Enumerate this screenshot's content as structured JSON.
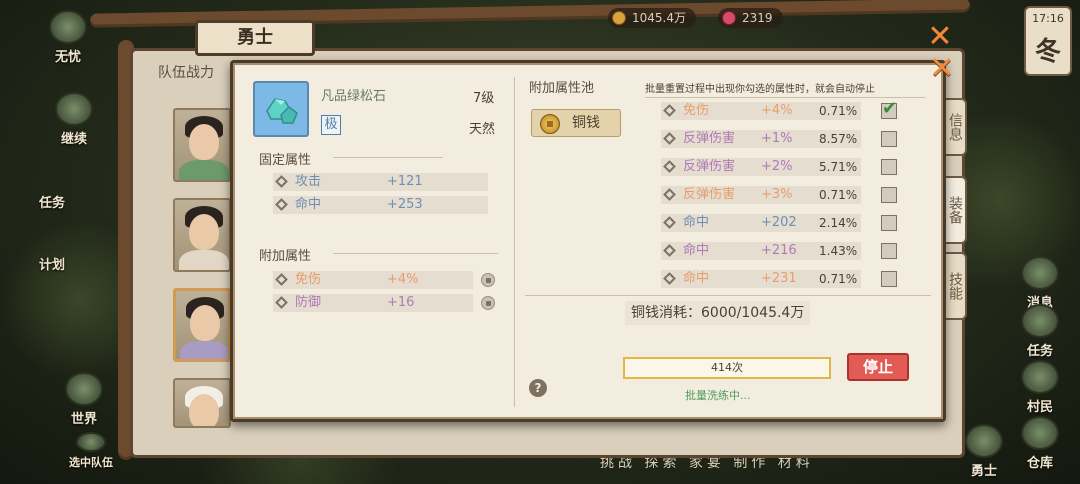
{
  "hud": {
    "coins": "1045.4万",
    "gems": "2319",
    "time": "17:16",
    "season": "冬",
    "left_menu": [
      {
        "label": "无忧"
      },
      {
        "label": "继续"
      },
      {
        "label": "任务"
      },
      {
        "label": "计划"
      },
      {
        "label": "世界"
      },
      {
        "label": "选中队伍"
      }
    ],
    "right_menu": [
      {
        "label": "消息"
      },
      {
        "label": "任务"
      },
      {
        "label": "村民"
      },
      {
        "label": "仓库"
      },
      {
        "label": "勇士"
      }
    ],
    "bottom_tabs": "挑战 探索 家宴 制作 材料"
  },
  "back_panel": {
    "title": "勇士",
    "tab_label": "队伍战力",
    "side_tabs": [
      "信息",
      "装备",
      "技能"
    ]
  },
  "dialog": {
    "item": {
      "name": "凡品绿松石",
      "level": "7级",
      "grade": "极",
      "origin": "天然"
    },
    "fixed_section_title": "固定属性",
    "fixed_attrs": [
      {
        "name": "攻击",
        "value": "+121"
      },
      {
        "name": "命中",
        "value": "+253"
      }
    ],
    "extra_section_title": "附加属性",
    "extra_attrs": [
      {
        "name": "免伤",
        "value": "+4%"
      },
      {
        "name": "防御",
        "value": "+16"
      }
    ],
    "pool": {
      "title": "附加属性池",
      "hint": "批量重置过程中出现你勾选的属性时，就会自动停止",
      "currency_button": "铜钱",
      "rows": [
        {
          "name": "免伤",
          "value": "+4%",
          "chance": "0.71%",
          "checked": true
        },
        {
          "name": "反弹伤害",
          "value": "+1%",
          "chance": "8.57%",
          "checked": false
        },
        {
          "name": "反弹伤害",
          "value": "+2%",
          "chance": "5.71%",
          "checked": false
        },
        {
          "name": "反弹伤害",
          "value": "+3%",
          "chance": "0.71%",
          "checked": false
        },
        {
          "name": "命中",
          "value": "+202",
          "chance": "2.14%",
          "checked": false
        },
        {
          "name": "命中",
          "value": "+216",
          "chance": "1.43%",
          "checked": false
        },
        {
          "name": "命中",
          "value": "+231",
          "chance": "0.71%",
          "checked": false
        }
      ]
    },
    "cost": "铜钱消耗：6000/1045.4万",
    "progress_text": "414次",
    "stop_button": "停止",
    "status": "批量洗练中...",
    "help_icon": "?"
  },
  "colors": {
    "accent_orange": "#f08a3a",
    "stop_red": "#e25b55",
    "progress_border": "#e0b84a",
    "check_green": "#3d8a3a"
  }
}
